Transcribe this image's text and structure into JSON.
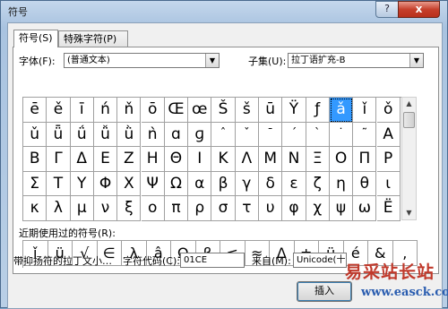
{
  "window": {
    "title": "符号",
    "help_icon": "?",
    "close_icon": "x"
  },
  "tabs": [
    {
      "label": "符号(S)"
    },
    {
      "label": "特殊字符(P)"
    }
  ],
  "font": {
    "label": "字体(F):",
    "value": "(普通文本)"
  },
  "subset": {
    "label": "子集(U):",
    "value": "拉丁语扩充-B"
  },
  "symbols": [
    [
      "ē",
      "ě",
      "ī",
      "ń",
      "ň",
      "ō",
      "Œ",
      "œ",
      "Š",
      "š",
      "ū",
      "Ÿ",
      "ƒ",
      "ǎ",
      "ǐ",
      "ǒ"
    ],
    [
      "ǔ",
      "ǖ",
      "ǘ",
      "ǚ",
      "ǜ",
      "ǹ",
      "ɑ",
      "ɡ",
      "ˆ",
      "ˇ",
      "ˉ",
      "ˊ",
      "ˋ",
      "˙",
      "˜",
      "A"
    ],
    [
      "B",
      "Γ",
      "Δ",
      "E",
      "Z",
      "H",
      "Θ",
      "I",
      "K",
      "Λ",
      "M",
      "N",
      "Ξ",
      "O",
      "Π",
      "P"
    ],
    [
      "Σ",
      "T",
      "Y",
      "Φ",
      "X",
      "Ψ",
      "Ω",
      "α",
      "β",
      "γ",
      "δ",
      "ε",
      "ζ",
      "η",
      "θ",
      "ι"
    ],
    [
      "κ",
      "λ",
      "μ",
      "ν",
      "ξ",
      "ο",
      "π",
      "ρ",
      "σ",
      "τ",
      "υ",
      "φ",
      "χ",
      "ψ",
      "ω",
      "Ë"
    ]
  ],
  "selected_symbol": "ǎ",
  "recent": {
    "label": "近期使用过的符号(R):",
    "items": [
      "ǐ",
      "ü",
      "√",
      "∈",
      "λ",
      "â",
      "Ω",
      "β",
      "≤",
      "≈",
      "Δ",
      "±",
      "ü",
      "é",
      "&",
      ","
    ]
  },
  "bottom": {
    "name_text": "带抑扬符的拉丁文小…",
    "code_label": "字符代码(C):",
    "code_value": "01CE",
    "from_label": "来自(M):",
    "from_value": "Unicode(十"
  },
  "insert_button": "插入",
  "watermark": {
    "line1": "易采站长站",
    "line2": "www.easck.com"
  }
}
